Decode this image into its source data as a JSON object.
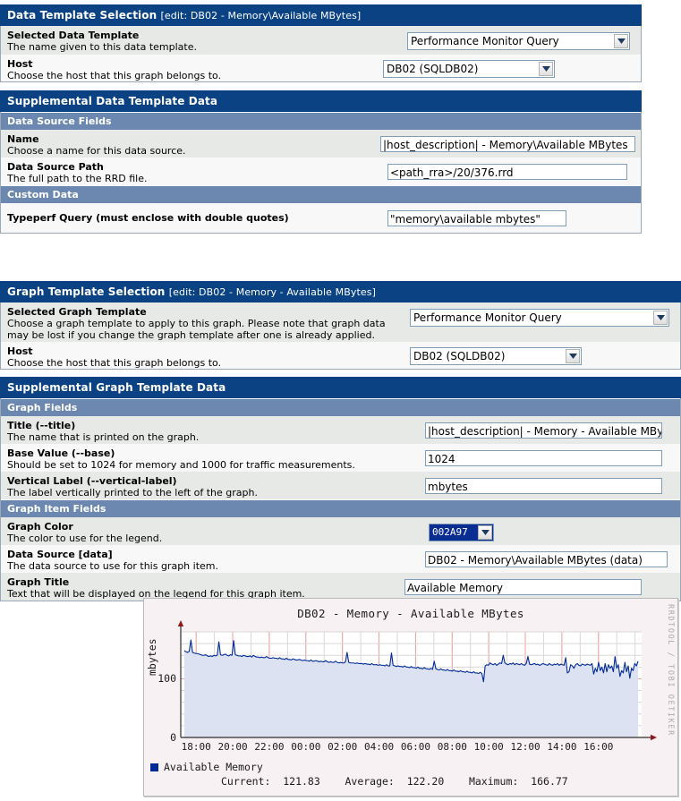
{
  "data_template_panel": {
    "header_title": "Data Template Selection",
    "header_edit": "[edit: DB02 - Memory\\Available MBytes]",
    "rows": [
      {
        "label": "Selected Data Template",
        "desc": "The name given to this data template.",
        "value": "Performance Monitor Query",
        "control": "select"
      },
      {
        "label": "Host",
        "desc": "Choose the host that this graph belongs to.",
        "value": "DB02 (SQLDB02)",
        "control": "select"
      }
    ]
  },
  "supplemental_data_panel": {
    "header_title": "Supplemental Data Template Data",
    "sections": [
      {
        "subheader": "Data Source Fields",
        "rows": [
          {
            "label": "Name",
            "desc": "Choose a name for this data source.",
            "value": "|host_description| - Memory\\Available MBytes"
          },
          {
            "label": "Data Source Path",
            "desc": "The full path to the RRD file.",
            "value": "<path_rra>/20/376.rrd"
          }
        ]
      },
      {
        "subheader": "Custom Data",
        "rows": [
          {
            "label": "Typeperf Query (must enclose with double quotes)",
            "desc": "",
            "value": "\"memory\\available mbytes\""
          }
        ]
      }
    ]
  },
  "graph_template_panel": {
    "header_title": "Graph Template Selection",
    "header_edit": "[edit: DB02 - Memory - Available MBytes]",
    "rows": [
      {
        "label": "Selected Graph Template",
        "desc": "Choose a graph template to apply to this graph. Please note that graph data may be lost if you change the graph template after one is already applied.",
        "value": "Performance Monitor Query",
        "control": "select"
      },
      {
        "label": "Host",
        "desc": "Choose the host that this graph belongs to.",
        "value": "DB02 (SQLDB02)",
        "control": "select"
      }
    ]
  },
  "supplemental_graph_panel": {
    "header_title": "Supplemental Graph Template Data",
    "sections": [
      {
        "subheader": "Graph Fields",
        "rows": [
          {
            "label": "Title (--title)",
            "desc": "The name that is printed on the graph.",
            "value": "|host_description| - Memory - Available MBytes"
          },
          {
            "label": "Base Value (--base)",
            "desc": "Should be set to 1024 for memory and 1000 for traffic measurements.",
            "value": "1024"
          },
          {
            "label": "Vertical Label (--vertical-label)",
            "desc": "The label vertically printed to the left of the graph.",
            "value": "mbytes"
          }
        ]
      },
      {
        "subheader": "Graph Item Fields",
        "rows": [
          {
            "label": "Graph Color",
            "desc": "The color to use for the legend.",
            "value": "002A97",
            "control": "color-select"
          },
          {
            "label": "Data Source [data]",
            "desc": "The data source to use for this graph item.",
            "value": "DB02 - Memory\\Available MBytes (data)"
          },
          {
            "label": "Graph Title",
            "desc": "Text that will be displayed on the legend for this graph item.",
            "value": "Available Memory"
          }
        ]
      }
    ]
  },
  "chart_data": {
    "type": "line",
    "title": "DB02 - Memory - Available MBytes",
    "xlabel": "",
    "ylabel": "mbytes",
    "ylim": [
      0,
      180
    ],
    "ytick_labels": [
      "0",
      "100"
    ],
    "ytick_values": [
      0,
      100
    ],
    "xtick_labels": [
      "18:00",
      "20:00",
      "22:00",
      "00:00",
      "02:00",
      "04:00",
      "06:00",
      "08:00",
      "10:00",
      "12:00",
      "14:00",
      "16:00"
    ],
    "grid": true,
    "legend_position": "bottom-left",
    "watermark": "RRDTOOL / TOBI OETIKER",
    "series": [
      {
        "name": "Available Memory",
        "color": "#002a97",
        "fill_color": "#dde2f2",
        "current": "121.83",
        "average": "122.20",
        "maximum": "166.77",
        "values": [
          148,
          146,
          145,
          147,
          166,
          145,
          144,
          143,
          143,
          142,
          141,
          140,
          140,
          141,
          139,
          138,
          139,
          138,
          140,
          139,
          140,
          163,
          141,
          140,
          141,
          142,
          140,
          139,
          141,
          140,
          165,
          141,
          140,
          139,
          139,
          138,
          140,
          139,
          138,
          138,
          139,
          137,
          140,
          138,
          137,
          137,
          136,
          137,
          136,
          136,
          138,
          136,
          135,
          135,
          136,
          135,
          135,
          134,
          136,
          134,
          134,
          133,
          135,
          133,
          133,
          132,
          134,
          133,
          132,
          132,
          133,
          132,
          131,
          132,
          131,
          131,
          130,
          132,
          130,
          130,
          131,
          130,
          129,
          130,
          129,
          129,
          131,
          129,
          128,
          129,
          128,
          128,
          130,
          128,
          127,
          128,
          127,
          127,
          129,
          145,
          128,
          127,
          127,
          127,
          126,
          127,
          126,
          126,
          126,
          125,
          126,
          125,
          125,
          124,
          126,
          124,
          124,
          124,
          123,
          124,
          123,
          123,
          122,
          124,
          122,
          122,
          144,
          123,
          122,
          121,
          122,
          121,
          121,
          120,
          122,
          120,
          120,
          119,
          121,
          119,
          119,
          118,
          120,
          118,
          118,
          117,
          119,
          117,
          117,
          116,
          118,
          116,
          130,
          117,
          116,
          115,
          117,
          115,
          115,
          114,
          116,
          114,
          114,
          113,
          115,
          113,
          113,
          112,
          114,
          112,
          112,
          111,
          113,
          111,
          111,
          110,
          112,
          110,
          110,
          109,
          111,
          109,
          95,
          122,
          124,
          123,
          127,
          125,
          124,
          126,
          123,
          125,
          127,
          126,
          140,
          127,
          125,
          124,
          126,
          125,
          127,
          124,
          126,
          125,
          124,
          126,
          124,
          123,
          126,
          138,
          125,
          124,
          125,
          126,
          124,
          125,
          123,
          124,
          126,
          125,
          124,
          123,
          126,
          124,
          123,
          125,
          124,
          126,
          123,
          125,
          124,
          123,
          136,
          110,
          112,
          124,
          122,
          118,
          124,
          126,
          123,
          122,
          125,
          124,
          123,
          125,
          124,
          123,
          126,
          108,
          118,
          112,
          128,
          114,
          120,
          110,
          126,
          112,
          124,
          118,
          122,
          112,
          138,
          118,
          124,
          104,
          114,
          110,
          128,
          112,
          122,
          101,
          118,
          114,
          126,
          122,
          130
        ]
      }
    ]
  }
}
